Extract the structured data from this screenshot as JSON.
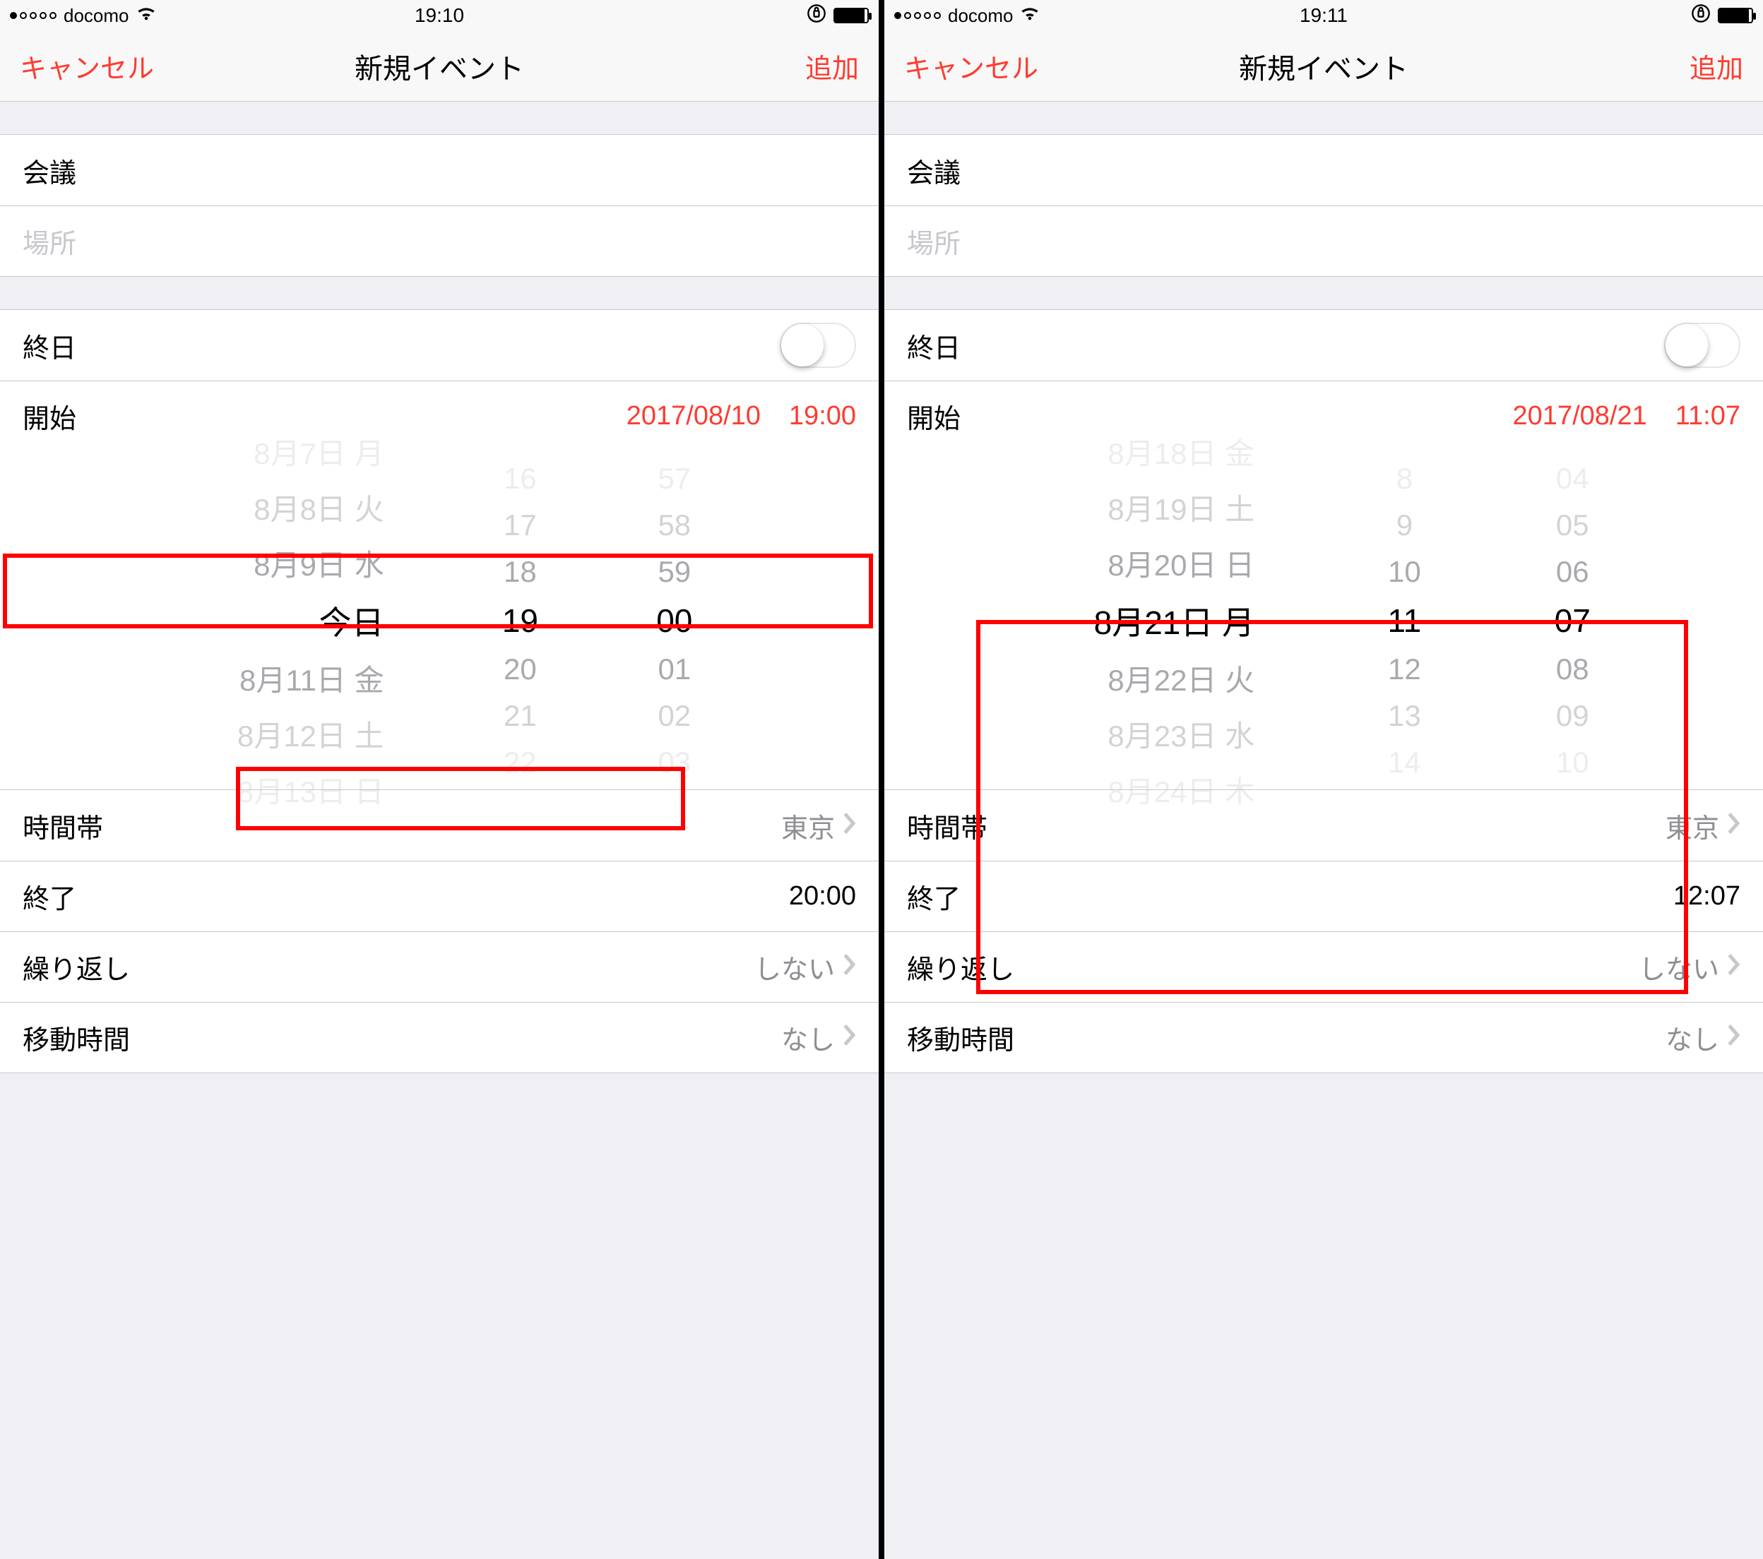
{
  "screens": {
    "left": {
      "status": {
        "carrier": "docomo",
        "time": "19:10",
        "battery_pct": 92
      },
      "nav": {
        "cancel": "キャンセル",
        "title": "新規イベント",
        "add": "追加"
      },
      "event_title": "会議",
      "location_ph": "場所",
      "allday_label": "終日",
      "start": {
        "label": "開始",
        "date": "2017/08/10",
        "time": "19:00"
      },
      "picker": {
        "dates": [
          "8月7日 月",
          "8月8日 火",
          "8月9日 水",
          "今日",
          "8月11日 金",
          "8月12日 土",
          "8月13日 日"
        ],
        "hours": [
          "16",
          "17",
          "18",
          "19",
          "20",
          "21",
          "22"
        ],
        "mins": [
          "57",
          "58",
          "59",
          "00",
          "01",
          "02",
          "03"
        ]
      },
      "timezone": {
        "label": "時間帯",
        "value": "東京"
      },
      "end": {
        "label": "終了",
        "value": "20:00"
      },
      "repeat": {
        "label": "繰り返し",
        "value": "しない"
      },
      "travel": {
        "label": "移動時間",
        "value": "なし"
      }
    },
    "right": {
      "status": {
        "carrier": "docomo",
        "time": "19:11",
        "battery_pct": 92
      },
      "nav": {
        "cancel": "キャンセル",
        "title": "新規イベント",
        "add": "追加"
      },
      "event_title": "会議",
      "location_ph": "場所",
      "allday_label": "終日",
      "start": {
        "label": "開始",
        "date": "2017/08/21",
        "time": "11:07"
      },
      "picker": {
        "dates": [
          "8月18日 金",
          "8月19日 土",
          "8月20日 日",
          "8月21日 月",
          "8月22日 火",
          "8月23日 水",
          "8月24日 木"
        ],
        "hours": [
          "8",
          "9",
          "10",
          "11",
          "12",
          "13",
          "14"
        ],
        "mins": [
          "04",
          "05",
          "06",
          "07",
          "08",
          "09",
          "10"
        ]
      },
      "timezone": {
        "label": "時間帯",
        "value": "東京"
      },
      "end": {
        "label": "終了",
        "value": "12:07"
      },
      "repeat": {
        "label": "繰り返し",
        "value": "しない"
      },
      "travel": {
        "label": "移動時間",
        "value": "なし"
      }
    }
  }
}
